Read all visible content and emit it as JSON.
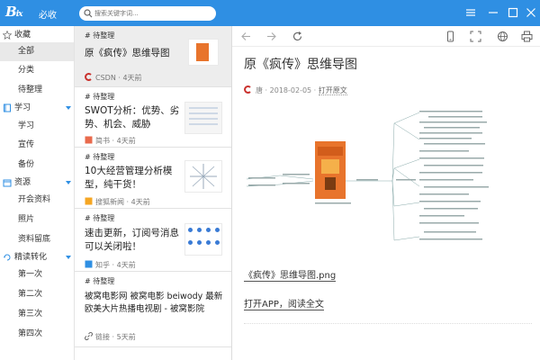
{
  "titlebar": {
    "logo_text": "B",
    "logo_sub": "必收",
    "search_placeholder": "搜索关键字词...",
    "colors": {
      "bar": "#2f8fe3"
    }
  },
  "sidebar": {
    "items": [
      {
        "label": "收藏",
        "kind": "header",
        "icon": "star-icon"
      },
      {
        "label": "全部",
        "kind": "sub",
        "active": true
      },
      {
        "label": "分类",
        "kind": "sub"
      },
      {
        "label": "待整理",
        "kind": "sub"
      },
      {
        "label": "学习",
        "kind": "group",
        "icon": "book-icon"
      },
      {
        "label": "学习",
        "kind": "sub"
      },
      {
        "label": "宣传",
        "kind": "sub"
      },
      {
        "label": "备份",
        "kind": "sub"
      },
      {
        "label": "资源",
        "kind": "group",
        "icon": "folder-icon"
      },
      {
        "label": "开会资料",
        "kind": "sub"
      },
      {
        "label": "照片",
        "kind": "sub"
      },
      {
        "label": "资料留底",
        "kind": "sub"
      },
      {
        "label": "精读转化",
        "kind": "group",
        "icon": "cycle-icon"
      },
      {
        "label": "第一次",
        "kind": "sub"
      },
      {
        "label": "第二次",
        "kind": "sub"
      },
      {
        "label": "第三次",
        "kind": "sub"
      },
      {
        "label": "第四次",
        "kind": "sub"
      }
    ]
  },
  "list": {
    "cards": [
      {
        "tag": "# 待整理",
        "title": "原《疯传》思维导图",
        "source": "CSDN",
        "time": "4天前"
      },
      {
        "tag": "# 待整理",
        "title": "SWOT分析：优势、劣势、机会、威胁",
        "source": "简书",
        "time": "4天前"
      },
      {
        "tag": "# 待整理",
        "title": "10大经营管理分析模型，纯干货！",
        "source": "搜狐新闻",
        "time": "4天前"
      },
      {
        "tag": "# 待整理",
        "title": "速击更新，订阅号消息可以关闭啦！",
        "source": "知乎",
        "time": "4天前"
      },
      {
        "tag": "# 待整理",
        "title": "被窝电影网 被窝电影 beiwody 最新欧美大片热播电视剧 - 被窝影院",
        "source": "链接",
        "time": "5天前"
      }
    ]
  },
  "content": {
    "title": "原《疯传》思维导图",
    "meta_author": "唐",
    "meta_date": "2018-02-05",
    "meta_link": "打开原文",
    "file_link": "《疯传》思维导图.png",
    "read_link": "打开APP，阅读全文"
  }
}
